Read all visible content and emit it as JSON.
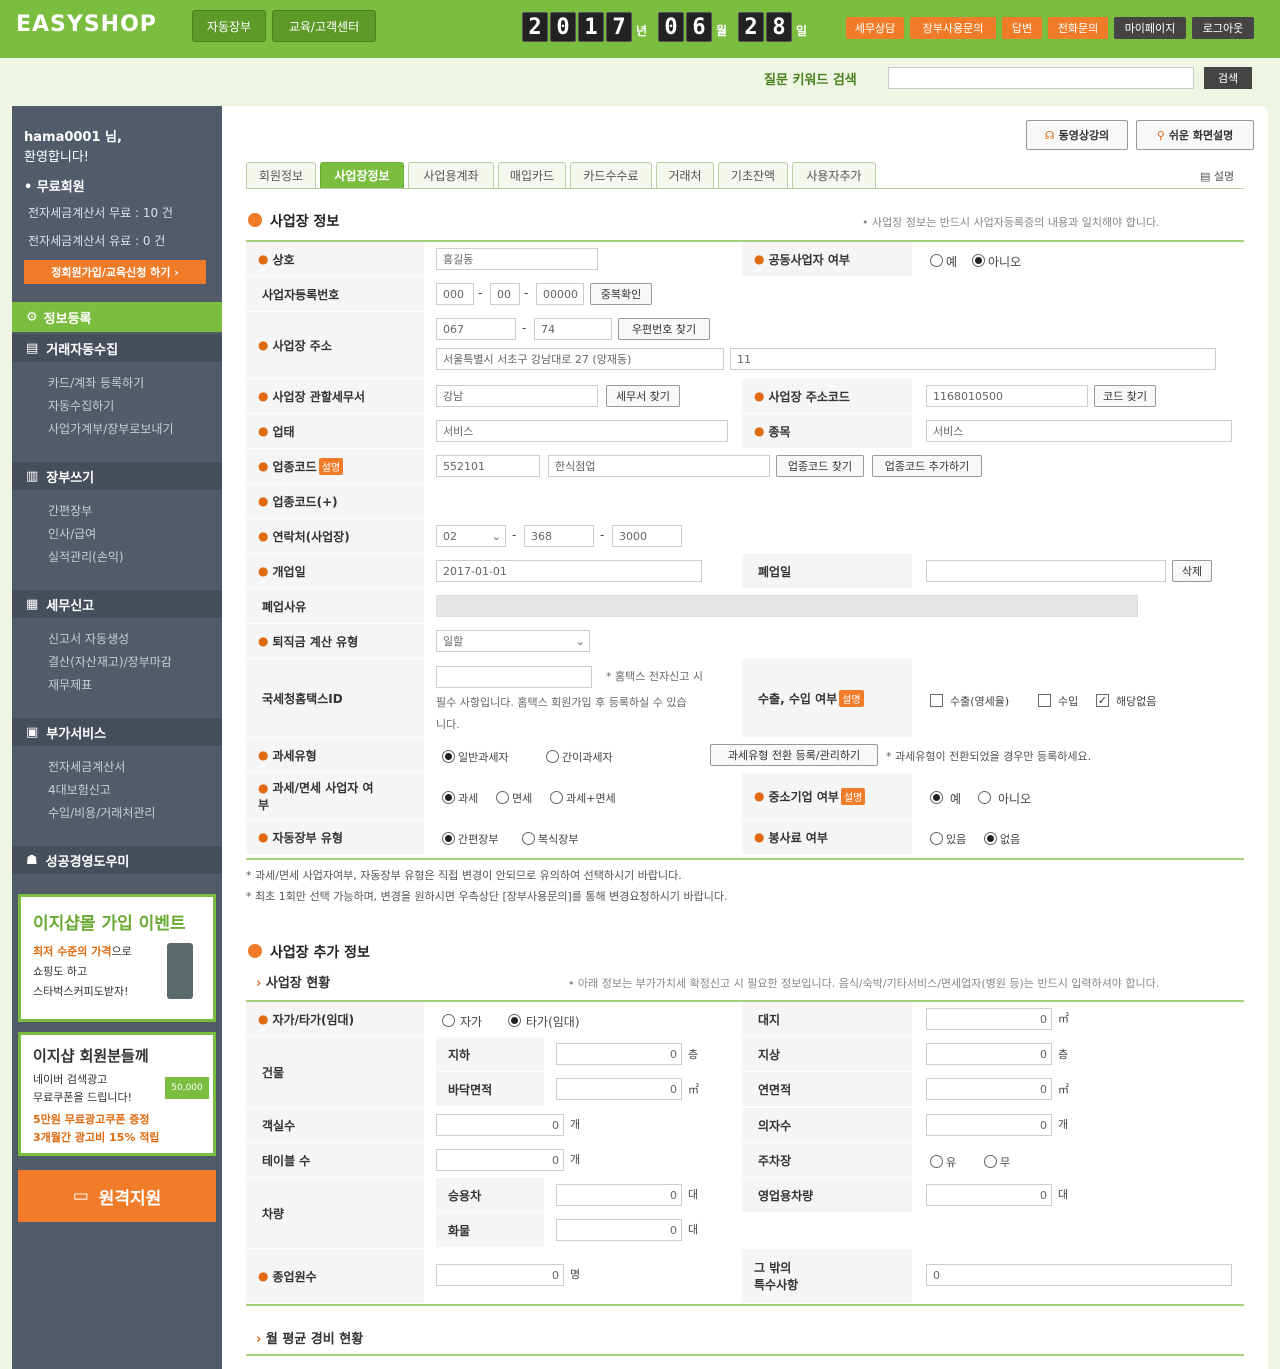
{
  "header": {
    "logo": "EASYSHOP",
    "nav": [
      "자동장부",
      "교육/고객센터"
    ],
    "date": {
      "year": [
        "2",
        "0",
        "1",
        "7"
      ],
      "year_unit": "년",
      "month": [
        "0",
        "6"
      ],
      "month_unit": "월",
      "day": [
        "2",
        "8"
      ],
      "day_unit": "일"
    },
    "links": [
      "세무상담",
      "장부사용문의",
      "답변",
      "전화문의",
      "마이페이지",
      "로그아웃"
    ],
    "search_label": "질문 키워드 검색",
    "search_button": "검색"
  },
  "sidebar": {
    "greeting1": "hama0001 님,",
    "greeting2": "환영합니다!",
    "member": "• 무료회원",
    "stat1": "전자세금계산서 무료 : 10 건",
    "stat2": "전자세금계산서 유료 : 0 건",
    "cta": "정회원가입/교육신청 하기 ›",
    "menu_active": "정보등록",
    "groups": [
      {
        "title": "거래자동수집",
        "items": [
          "카드/계좌 등록하기",
          "자동수집하기",
          "사업가계부/장부로보내기"
        ]
      },
      {
        "title": "장부쓰기",
        "items": [
          "간편장부",
          "인사/급여",
          "실적관리(손익)"
        ]
      },
      {
        "title": "세무신고",
        "items": [
          "신고서 자동생성",
          "결산(자산재고)/장부마감",
          "재무제표"
        ]
      },
      {
        "title": "부가서비스",
        "items": [
          "전자세금계산서",
          "4대보험신고",
          "수입/비용/거래처관리"
        ]
      },
      {
        "title": "성공경영도우미",
        "items": []
      }
    ],
    "promo1": {
      "title": "이지샵몰 가입 이벤트",
      "line1": "최저 수준의 가격",
      "line1b": "으로",
      "line2": "쇼핑도 하고",
      "line3": "스타벅스커피도받자!"
    },
    "promo2": {
      "title": "이지샵 회원분들께",
      "line1": "네이버 검색광고",
      "line2": "무료쿠폰을 드립니다!",
      "coupon": "50,000",
      "line3": "5만원 무료광고쿠폰 증정",
      "line4": "3개월간 광고비 15% 적립"
    },
    "remote": "원격지원"
  },
  "content": {
    "video_button": "동영상강의",
    "help_button": "쉬운 화면설명",
    "tabs": [
      "회원정보",
      "사업장정보",
      "사업용계좌",
      "매입카드",
      "카드수수료",
      "거래처",
      "기초잔액",
      "사용자추가"
    ],
    "desc": "설명",
    "sec1": {
      "title": "사업장 정보",
      "note": "• 사업장 정보는 반드시 사업자등록증의 내용과 일치해야 합니다."
    },
    "labels": {
      "name": "상호",
      "joint": "공동사업자 여부",
      "bizno": "사업자등록번호",
      "addr": "사업장 주소",
      "office": "사업장 관할세무서",
      "addrcode": "사업장 주소코드",
      "type": "업태",
      "item": "종목",
      "indcode": "업종코드",
      "indcode2": "업종코드(+)",
      "phone": "연락처(사업장)",
      "open": "개업일",
      "close": "폐업일",
      "close_reason": "폐업사유",
      "retire": "퇴직금 계산 유형",
      "hometax": "국세청홈택스ID",
      "export": "수출, 수입 여부",
      "taxtype": "과세유형",
      "taxfree": "과세/면세 사업자 여",
      "taxfree2": "부",
      "sme": "중소기업 여부",
      "bookkeep": "자동장부 유형",
      "service": "봉사료 여부"
    },
    "values": {
      "name": "홍길동",
      "yes": "예",
      "no": "아니오",
      "biz1": "000",
      "biz2": "00",
      "biz3": "00000",
      "dup": "중복확인",
      "zip1": "067",
      "zip2": "74",
      "zipbtn": "우편번호 찾기",
      "addr1": "서울특별시 서초구 강남대로 27 (양재동)",
      "addr2": "11",
      "office": "강남",
      "officebtn": "세무서 찾기",
      "addrcode": "1168010500",
      "codebtn": "코드 찾기",
      "type": "서비스",
      "item": "서비스",
      "indcode": "552101",
      "indname": "한식점업",
      "indbtn": "업종코드 찾기",
      "indadd": "업종코드 추가하기",
      "badge": "설명",
      "ph1": "02",
      "ph2": "368",
      "ph3": "3000",
      "open": "2017-01-01",
      "del": "삭제",
      "retire": "일할",
      "ht_note1": "* 홈택스 전자신고 시",
      "ht_note2": "필수 사항입니다. 홈택스 회원가입 후 등록하실 수 있습",
      "ht_note3": "니다.",
      "exp1": "수출(영세율)",
      "exp2": "수입",
      "exp3": "해당없음",
      "tax1": "일반과세자",
      "tax2": "간이과세자",
      "taxbtn": "과세유형 전환 등록/관리하기",
      "taxnote": "* 과세유형이 전환되었을 경우만 등록하세요.",
      "tf1": "과세",
      "tf2": "면세",
      "tf3": "과세+면세",
      "bk1": "간편장부",
      "bk2": "복식장부",
      "sv1": "있음",
      "sv2": "없음"
    },
    "notes": [
      "* 과세/면세 사업자여부, 자동장부 유형은 직접 변경이 안되므로 유의하여 선택하시기 바랍니다.",
      "* 최초 1회만 선택 가능하며, 변경을 원하시면 우측상단 [장부사용문의]를 통해 변경요청하시기 바랍니다."
    ],
    "sec2": {
      "title": "사업장 추가 정보",
      "sub": "사업장 현황",
      "note": "• 아래 정보는 부가가치세 확정신고 시 필요한 정보입니다. 음식/숙박/기타서비스/면세업자(병원 등)는 반드시 입력하셔야 합니다."
    },
    "labels2": {
      "own": "자가/타가(임대)",
      "land": "대지",
      "bldg": "건물",
      "under": "지하",
      "above": "지상",
      "floor": "바닥면적",
      "total": "연면적",
      "rooms": "객실수",
      "seats": "의자수",
      "tables": "테이블 수",
      "parking": "주차장",
      "vehicle": "차량",
      "car": "승용차",
      "biz_car": "영업용차량",
      "truck": "화물",
      "staff": "종업원수",
      "etc1": "그 밖의",
      "etc2": "특수사항"
    },
    "values2": {
      "own1": "자가",
      "own2": "타가(임대)",
      "zero": "0",
      "sqm": "㎡",
      "cheung": "층",
      "gae": "개",
      "dae": "대",
      "myeong": "명",
      "yu": "유",
      "mu": "무"
    },
    "sec3": {
      "sub": "월 평균 경비 현황"
    }
  }
}
